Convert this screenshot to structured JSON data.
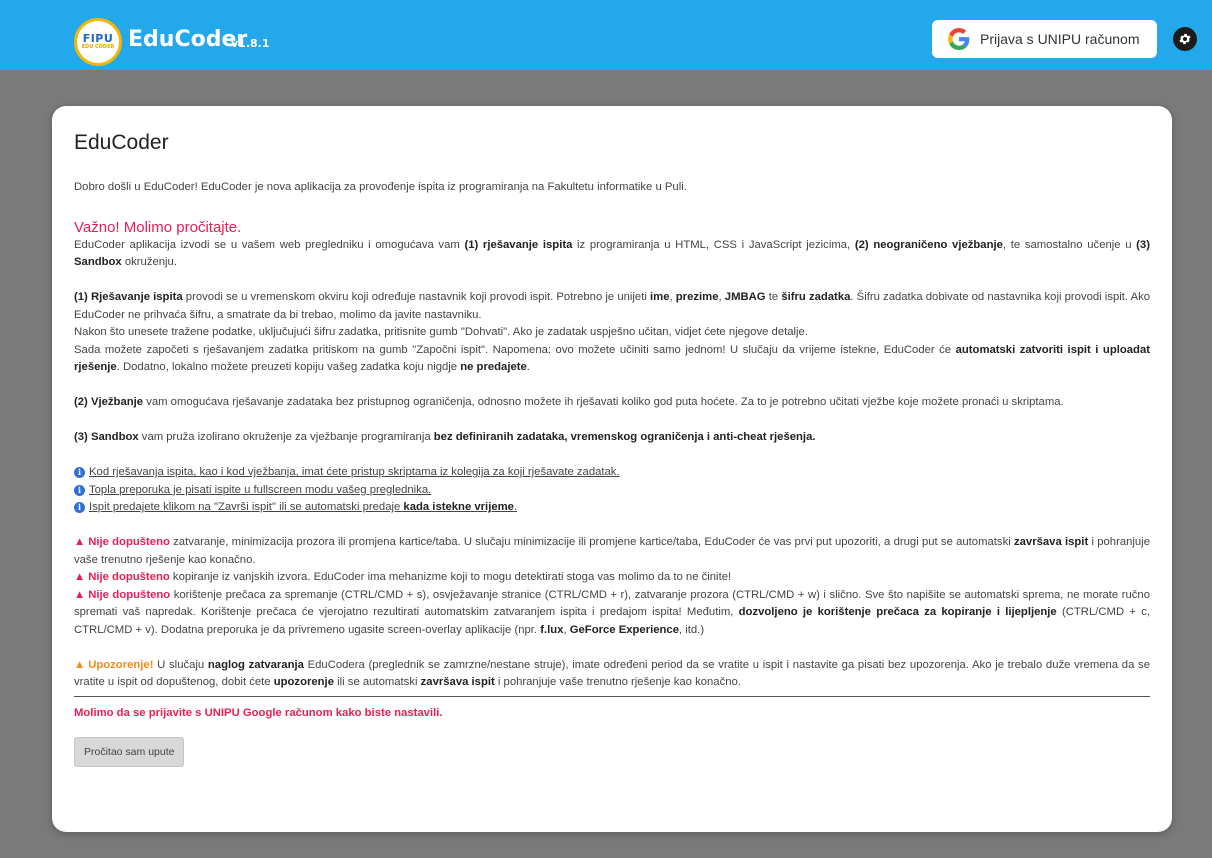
{
  "header": {
    "logo_top": "FIPU",
    "logo_bottom": "EDU CODER",
    "app_name": "EduCoder",
    "version": "v1.8.1",
    "login_label": "Prijava s UNIPU računom",
    "settings_icon": "gear-icon"
  },
  "card": {
    "title": "EduCoder",
    "intro": "Dobro došli u EduCoder! EduCoder je nova aplikacija za provođenje ispita iz programiranja na Fakultetu informatike u Puli.",
    "important_heading": "Važno! Molimo pročitajte.",
    "p1": {
      "a": "EduCoder aplikacija izvodi se u vašem web pregledniku i omogućava vam ",
      "b": "(1) rješavanje ispita",
      "c": " iz programiranja u HTML, CSS i JavaScript jezicima, ",
      "d": "(2) neograničeno vježbanje",
      "e": ", te samostalno učenje u ",
      "f": "(3) Sandbox",
      "g": " okruženju."
    },
    "p2": {
      "a": "(1) Rješavanje ispita",
      "b": " provodi se u vremenskom okviru koji određuje nastavnik koji provodi ispit. Potrebno je unijeti ",
      "c": "ime",
      "d": ", ",
      "e": "prezime",
      "f": ", ",
      "g": "JMBAG",
      "h": " te ",
      "i": "šifru zadatka",
      "j": ". Šifru zadatka dobivate od nastavnika koji provodi ispit. Ako EduCoder ne prihvaća šifru, a smatrate da bi trebao, molimo da javite nastavniku.",
      "k": "Nakon što unesete tražene podatke, uključujući šifru zadatka, pritisnite gumb \"Dohvati\". Ako je zadatak uspješno učitan, vidjet ćete njegove detalje.",
      "l": "Sada možete započeti s rješavanjem zadatka pritiskom na gumb \"Započni ispit\". Napomena: ovo možete učiniti samo jednom! U slučaju da vrijeme istekne, EduCoder će ",
      "m": "automatski zatvoriti ispit i uploadat rješenje",
      "n": ". Dodatno, lokalno možete preuzeti kopiju vašeg zadatka koju nigdje ",
      "o": "ne predajete",
      "p": "."
    },
    "p3": {
      "a": "(2) Vježbanje",
      "b": " vam omogućava rješavanje zadataka bez pristupnog ograničenja, odnosno možete ih rješavati koliko god puta hoćete. Za to je potrebno učitati vježbe koje možete pronaći u skriptama."
    },
    "p4": {
      "a": "(3) Sandbox",
      "b": " vam pruža izolirano okruženje za vježbanje programiranja ",
      "c": "bez definiranih zadataka, vremenskog ograničenja i anti-cheat rješenja."
    },
    "info": {
      "i1": "Kod rješavanja ispita, kao i kod vježbanja, imat ćete pristup skriptama iz kolegija za koji rješavate zadatak.",
      "i2": "Topla preporuka je pisati ispite u fullscreen modu vašeg preglednika.",
      "i3a": "Ispit predajete klikom na \"Završi ispit\" ili se automatski predaje ",
      "i3b": "kada istekne vrijeme",
      "i3c": "."
    },
    "rules": {
      "r1a": "Nije dopušteno",
      "r1b": " zatvaranje, minimizacija prozora ili promjena kartice/taba. U slučaju minimizacije ili promjene kartice/taba, EduCoder će vas prvi put upozoriti, a drugi put se automatski ",
      "r1c": "završava ispit",
      "r1d": " i pohranjuje vaše trenutno rješenje kao konačno.",
      "r2a": "Nije dopušteno",
      "r2b": " kopiranje iz vanjskih izvora. EduCoder ima mehanizme koji to mogu detektirati stoga vas molimo da to ne činite!",
      "r3a": "Nije dopušteno",
      "r3b": " korištenje prečaca za spremanje (CTRL/CMD + s), osvježavanje stranice (CTRL/CMD + r), zatvaranje prozora (CTRL/CMD + w) i slično. Sve što napišite se automatski sprema, ne morate ručno spremati vaš napredak. Korištenje prečaca će vjerojatno rezultirati automatskim zatvaranjem ispita i predajom ispita! Međutim, ",
      "r3c": "dozvoljeno je korištenje prečaca za kopiranje i lijepljenje",
      "r3d": " (CTRL/CMD + c, CTRL/CMD + v). Dodatna preporuka je da privremeno ugasite screen-overlay aplikacije (npr. ",
      "r3e": "f.lux",
      "r3f": ", ",
      "r3g": "GeForce Experience",
      "r3h": ", itd.)"
    },
    "warning": {
      "a": "Upozorenje!",
      "b": " U slučaju ",
      "c": "naglog zatvaranja",
      "d": " EduCodera (preglednik se zamrzne/nestane struje), imate određeni period da se vratite u ispit i nastavite ga pisati bez upozorenja. Ako je trebalo duže vremena da se vratite u ispit od dopuštenog, dobit ćete ",
      "e": "upozorenje",
      "f": " ili se automatski ",
      "g": "završava ispit",
      "h": " i pohranjuje vaše trenutno rješenje kao konačno."
    },
    "login_prompt": "Molimo da se prijavite s UNIPU Google računom kako biste nastavili.",
    "ack_button": "Pročitao sam upute"
  },
  "colors": {
    "topbar": "#24a8ec",
    "accent_red": "#e81f55",
    "accent_orange": "#f08c1a",
    "info_blue": "#2f6fd6"
  }
}
